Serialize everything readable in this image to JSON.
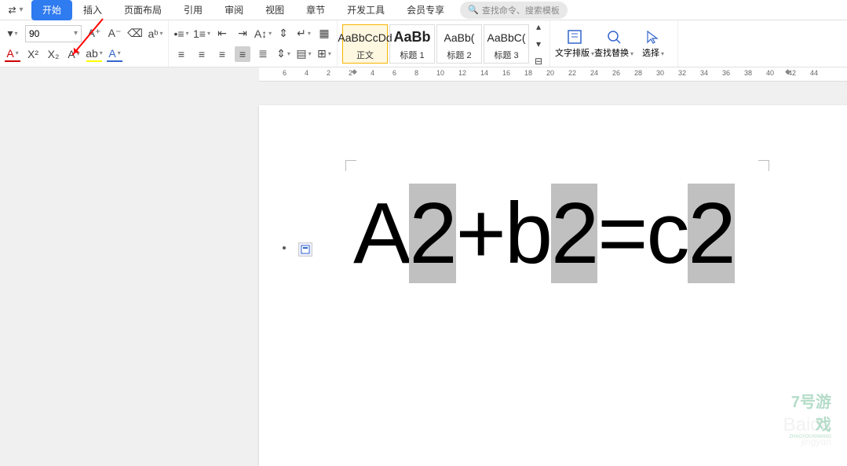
{
  "tabs": {
    "pre": "⇄",
    "items": [
      "开始",
      "插入",
      "页面布局",
      "引用",
      "审阅",
      "视图",
      "章节",
      "开发工具",
      "会员专享"
    ],
    "active_index": 0
  },
  "search": {
    "placeholder": "查找命令、搜索模板"
  },
  "ribbon": {
    "font_size": "90",
    "icons_row1": {
      "grow": "A⁺",
      "shrink": "A⁻",
      "eraser": "⌫",
      "pinyin": "aᵇ"
    },
    "icons_row2": {
      "font_color": "A",
      "super": "X²",
      "sub": "X₂",
      "char_border": "A",
      "highlight": "ab",
      "text_effect": "A"
    },
    "para_row1": {
      "bullets": "•≡",
      "num": "1≡",
      "outdent": "⇤",
      "indent": "⇥",
      "sort": "A↕",
      "line_h": "⇕",
      "wrap": "↵",
      "table": "▦"
    },
    "para_row2": {
      "align_l": "≡",
      "align_c": "≡",
      "align_r": "≡",
      "align_j": "≡",
      "dist": "≣",
      "line_sp": "⇕",
      "shade": "▤",
      "border": "⊞"
    },
    "styles": [
      {
        "preview": "AaBbCcDd",
        "label": "正文",
        "selected": true,
        "bold": false
      },
      {
        "preview": "AaBb",
        "label": "标题 1",
        "selected": false,
        "bold": true
      },
      {
        "preview": "AaBb(",
        "label": "标题 2",
        "selected": false,
        "bold": false
      },
      {
        "preview": "AaBbC(",
        "label": "标题 3",
        "selected": false,
        "bold": false
      }
    ],
    "big": {
      "text_layout": "文字排版",
      "find_replace": "查找替换",
      "select": "选择"
    }
  },
  "ruler": {
    "ticks": [
      6,
      4,
      2,
      2,
      4,
      6,
      8,
      10,
      12,
      14,
      16,
      18,
      20,
      22,
      24,
      26,
      28,
      30,
      32,
      34,
      36,
      38,
      40,
      42,
      44
    ]
  },
  "document": {
    "chars": [
      "A",
      "2",
      "+",
      "b",
      "2",
      "=",
      "c",
      "2"
    ],
    "selected": [
      1,
      4,
      7
    ]
  },
  "watermark": {
    "line1": "7号游戏",
    "line2": "ZHAOYOUXIWANG",
    "line3": "游戏",
    "baidu": "Baidu",
    "jy": "jingyan"
  }
}
